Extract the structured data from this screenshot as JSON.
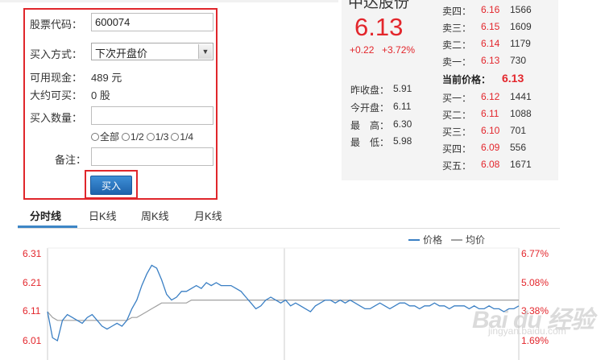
{
  "form": {
    "code_label": "股票代码：",
    "code_value": "600074",
    "method_label": "买入方式：",
    "method_value": "下次开盘价",
    "cash_label": "可用现金：",
    "cash_value": "489 元",
    "can_buy_label": "大约可买：",
    "can_buy_value": "0 股",
    "qty_label": "买入数量：",
    "qty_value": "",
    "ratios": [
      "全部",
      "1/2",
      "1/3",
      "1/4"
    ],
    "note_label": "备注：",
    "note_value": "",
    "buy_label": "买入"
  },
  "quote": {
    "name": "中达股份",
    "price": "6.13",
    "change": "+0.22",
    "change_pct": "+3.72%",
    "stats": [
      {
        "label": "昨收盘：",
        "value": "5.91",
        "color": "#333333"
      },
      {
        "label": "今开盘：",
        "value": "6.11",
        "color": "#e3262c"
      },
      {
        "label": "最　高：",
        "value": "6.30",
        "color": "#e3262c"
      },
      {
        "label": "最　低：",
        "value": "5.98",
        "color": "#e3262c"
      }
    ]
  },
  "order_book": {
    "sells": [
      {
        "label": "卖四：",
        "price": "6.16",
        "volume": "1566"
      },
      {
        "label": "卖三：",
        "price": "6.15",
        "volume": "1609"
      },
      {
        "label": "卖二：",
        "price": "6.14",
        "volume": "1179"
      },
      {
        "label": "卖一：",
        "price": "6.13",
        "volume": "730"
      }
    ],
    "current_label": "当前价格：",
    "current_value": "6.13",
    "buys": [
      {
        "label": "买一：",
        "price": "6.12",
        "volume": "1441"
      },
      {
        "label": "买二：",
        "price": "6.11",
        "volume": "1088"
      },
      {
        "label": "买三：",
        "price": "6.10",
        "volume": "701"
      },
      {
        "label": "买四：",
        "price": "6.09",
        "volume": "556"
      },
      {
        "label": "买五：",
        "price": "6.08",
        "volume": "1671"
      }
    ]
  },
  "tabs": [
    {
      "label": "分时线",
      "active": true
    },
    {
      "label": "日K线",
      "active": false
    },
    {
      "label": "周K线",
      "active": false
    },
    {
      "label": "月K线",
      "active": false
    }
  ],
  "colors": {
    "accent_red": "#e3262c",
    "price_line": "#3a7fc4",
    "avg_line": "#a0a0a0",
    "tab_active": "#3d86c6"
  },
  "chart_data": {
    "type": "line",
    "legend": [
      "价格",
      "均价"
    ],
    "y_left_ticks": [
      "6.31",
      "6.21",
      "6.11",
      "6.01"
    ],
    "y_right_ticks": [
      "6.77%",
      "5.08%",
      "3.38%",
      "1.69%"
    ],
    "ylim": [
      5.98,
      6.33
    ],
    "series": [
      {
        "name": "价格",
        "values": [
          6.11,
          6.02,
          6.01,
          6.08,
          6.1,
          6.09,
          6.08,
          6.07,
          6.09,
          6.1,
          6.08,
          6.06,
          6.05,
          6.06,
          6.07,
          6.06,
          6.08,
          6.12,
          6.15,
          6.2,
          6.24,
          6.27,
          6.26,
          6.22,
          6.17,
          6.15,
          6.16,
          6.18,
          6.18,
          6.19,
          6.2,
          6.19,
          6.21,
          6.2,
          6.21,
          6.2,
          6.2,
          6.2,
          6.19,
          6.18,
          6.16,
          6.14,
          6.12,
          6.13,
          6.15,
          6.16,
          6.15,
          6.14,
          6.15,
          6.13,
          6.14,
          6.13,
          6.12,
          6.11,
          6.13,
          6.14,
          6.15,
          6.15,
          6.14,
          6.15,
          6.14,
          6.15,
          6.14,
          6.13,
          6.12,
          6.12,
          6.13,
          6.14,
          6.13,
          6.12,
          6.13,
          6.14,
          6.14,
          6.13,
          6.13,
          6.12,
          6.13,
          6.13,
          6.14,
          6.13,
          6.13,
          6.12,
          6.13,
          6.13,
          6.13,
          6.12,
          6.13,
          6.12,
          6.12,
          6.13,
          6.12,
          6.12,
          6.11,
          6.12,
          6.12,
          6.13
        ]
      },
      {
        "name": "均价",
        "values": [
          6.11,
          6.09,
          6.08,
          6.08,
          6.08,
          6.08,
          6.08,
          6.08,
          6.08,
          6.08,
          6.08,
          6.08,
          6.08,
          6.08,
          6.08,
          6.08,
          6.08,
          6.09,
          6.09,
          6.1,
          6.11,
          6.12,
          6.13,
          6.14,
          6.14,
          6.14,
          6.14,
          6.14,
          6.14,
          6.15,
          6.15,
          6.15,
          6.15,
          6.15,
          6.15,
          6.15,
          6.15,
          6.15,
          6.15,
          6.15,
          6.15,
          6.15,
          6.15,
          6.15,
          6.15,
          6.15,
          6.15,
          6.15,
          6.15,
          6.15,
          6.15,
          6.15,
          6.15,
          6.15,
          6.15,
          6.15,
          6.15,
          6.15,
          6.15,
          6.15,
          6.15,
          6.15,
          6.15,
          6.15,
          6.15,
          6.15,
          6.15,
          6.15,
          6.15,
          6.15,
          6.15,
          6.15,
          6.15,
          6.15,
          6.15,
          6.15,
          6.15,
          6.15,
          6.15,
          6.15,
          6.15,
          6.15,
          6.15,
          6.15,
          6.15,
          6.15,
          6.15,
          6.15,
          6.15,
          6.15,
          6.15,
          6.15,
          6.15,
          6.15,
          6.15,
          6.15
        ]
      }
    ]
  },
  "watermark": {
    "text": "Bai du 经验",
    "sub": "jingyan.baidu.com"
  }
}
